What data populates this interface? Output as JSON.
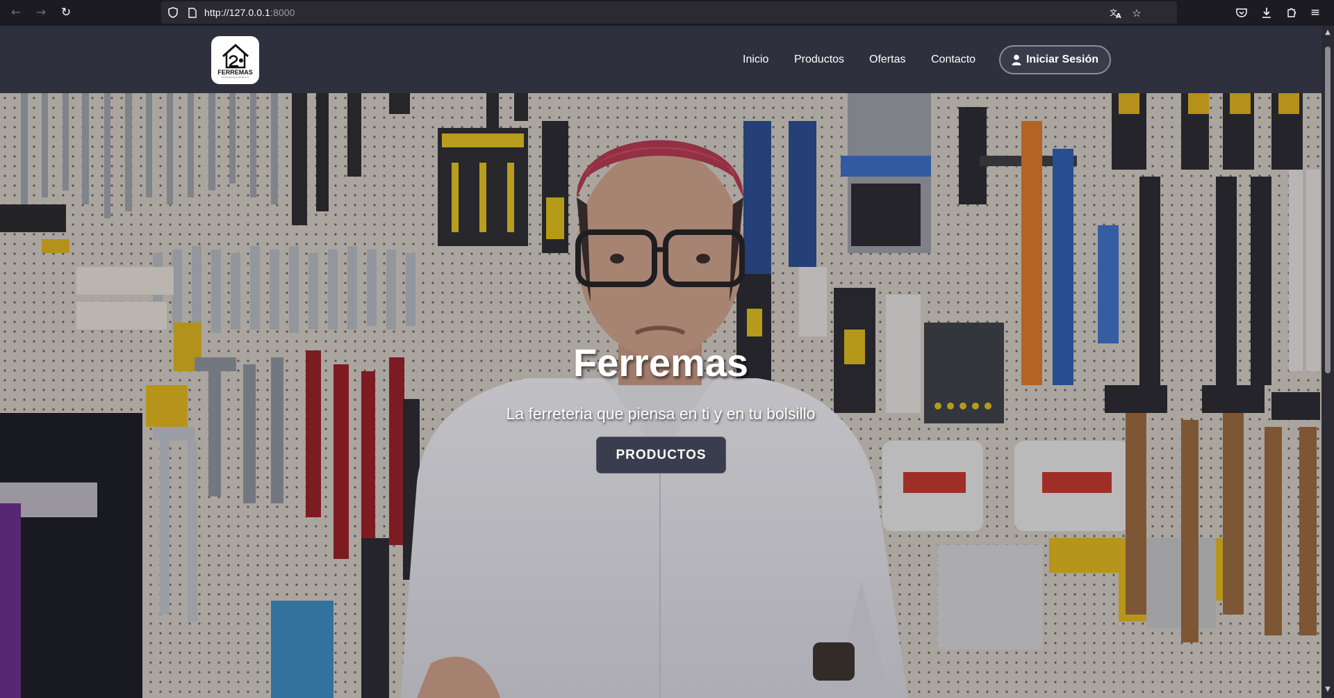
{
  "browser": {
    "url_host": "http://127.0.0.1",
    "url_port": ":8000"
  },
  "brand": {
    "logo_text": "FERREMAS",
    "logo_tagline": "La ferretería que piensa en ti"
  },
  "nav": {
    "items": [
      {
        "label": "Inicio"
      },
      {
        "label": "Productos"
      },
      {
        "label": "Ofertas"
      },
      {
        "label": "Contacto"
      }
    ],
    "login_label": "Iniciar Sesión"
  },
  "hero": {
    "title": "Ferremas",
    "subtitle": "La ferreteria que piensa en ti y en tu bolsillo",
    "button_label": "PRODUCTOS"
  },
  "colors": {
    "navbar_bg": "#2e303e",
    "button_bg": "#3a3d4d",
    "browser_bg": "#1c1b22"
  }
}
